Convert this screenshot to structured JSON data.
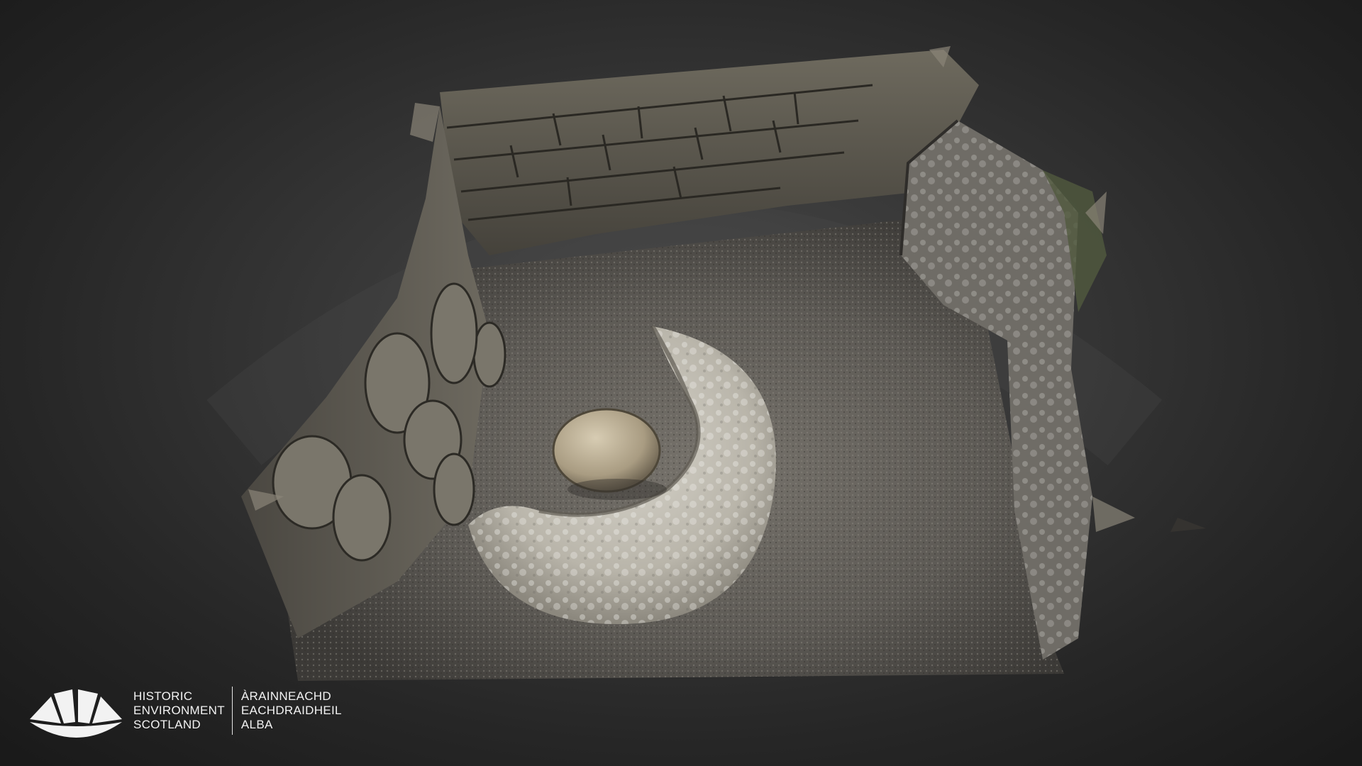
{
  "colors": {
    "background": "#2a2a2a",
    "logo": "#f2f2f2"
  },
  "logo": {
    "icon": "fan-icon",
    "english": [
      "HISTORIC",
      "ENVIRONMENT",
      "SCOTLAND"
    ],
    "gaelic": [
      "ÀRAINNEACHD",
      "EACHDRAIDHEIL",
      "ALBA"
    ]
  }
}
